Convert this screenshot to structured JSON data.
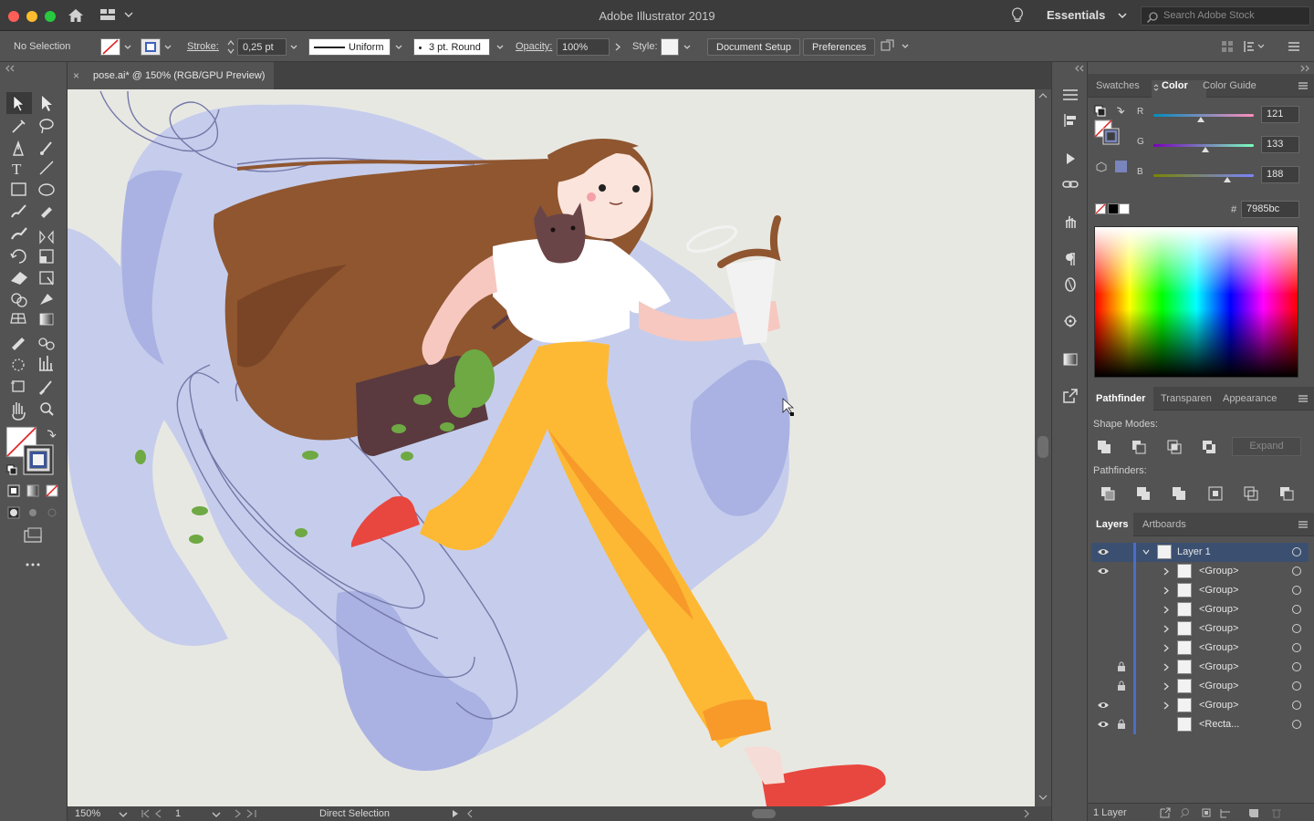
{
  "app": {
    "title": "Adobe Illustrator 2019",
    "workspace": "Essentials",
    "search_placeholder": "Search Adobe Stock"
  },
  "control_bar": {
    "selection": "No Selection",
    "stroke_label": "Stroke:",
    "stroke_value": "0,25 pt",
    "profile": "Uniform",
    "brush": "3 pt. Round",
    "opacity_label": "Opacity:",
    "opacity_value": "100%",
    "style_label": "Style:",
    "document_setup": "Document Setup",
    "preferences": "Preferences"
  },
  "document": {
    "tab_title": "pose.ai* @ 150% (RGB/GPU Preview)",
    "close_glyph": "×"
  },
  "status_bar": {
    "zoom": "150%",
    "artboard": "1",
    "tool": "Direct Selection"
  },
  "color_panel": {
    "tabs": [
      "Swatches",
      "Color",
      "Color Guide"
    ],
    "active_tab": "Color",
    "channels": [
      {
        "label": "R",
        "value": "121",
        "fraction": 0.474
      },
      {
        "label": "G",
        "value": "133",
        "fraction": 0.522
      },
      {
        "label": "B",
        "value": "188",
        "fraction": 0.737
      }
    ],
    "hex_label": "#",
    "hex_value": "7985bc",
    "fill_color": "#7985bc"
  },
  "pathfinder_panel": {
    "tabs": [
      "Pathfinder",
      "Transparen",
      "Appearance"
    ],
    "active_tab": "Pathfinder",
    "shape_modes_label": "Shape Modes:",
    "expand_label": "Expand",
    "pathfinders_label": "Pathfinders:"
  },
  "layers_panel": {
    "tabs": [
      "Layers",
      "Artboards"
    ],
    "active_tab": "Layers",
    "rows": [
      {
        "name": "Layer 1",
        "visible": true,
        "locked": false,
        "expanded": true
      },
      {
        "name": "<Group>",
        "visible": true,
        "locked": false
      },
      {
        "name": "<Group>",
        "visible": false,
        "locked": false
      },
      {
        "name": "<Group>",
        "visible": false,
        "locked": false
      },
      {
        "name": "<Group>",
        "visible": false,
        "locked": false
      },
      {
        "name": "<Group>",
        "visible": false,
        "locked": false
      },
      {
        "name": "<Group>",
        "visible": false,
        "locked": true
      },
      {
        "name": "<Group>",
        "visible": false,
        "locked": true
      },
      {
        "name": "<Group>",
        "visible": true,
        "locked": false
      },
      {
        "name": "<Recta...",
        "visible": true,
        "locked": true
      }
    ],
    "footer": "1 Layer"
  },
  "colors": {
    "accent_selection": "#3b4f70",
    "layer_color": "#4c6ec6",
    "canvas_bg": "#e8e8e3",
    "blob": "#c5cbeb",
    "blob_dark": "#a5afe0",
    "hair": "#8f5630",
    "pants": "#fdb934",
    "shoe": "#e8473f",
    "bag": "#5a3a3f",
    "leaves": "#6ea943"
  }
}
